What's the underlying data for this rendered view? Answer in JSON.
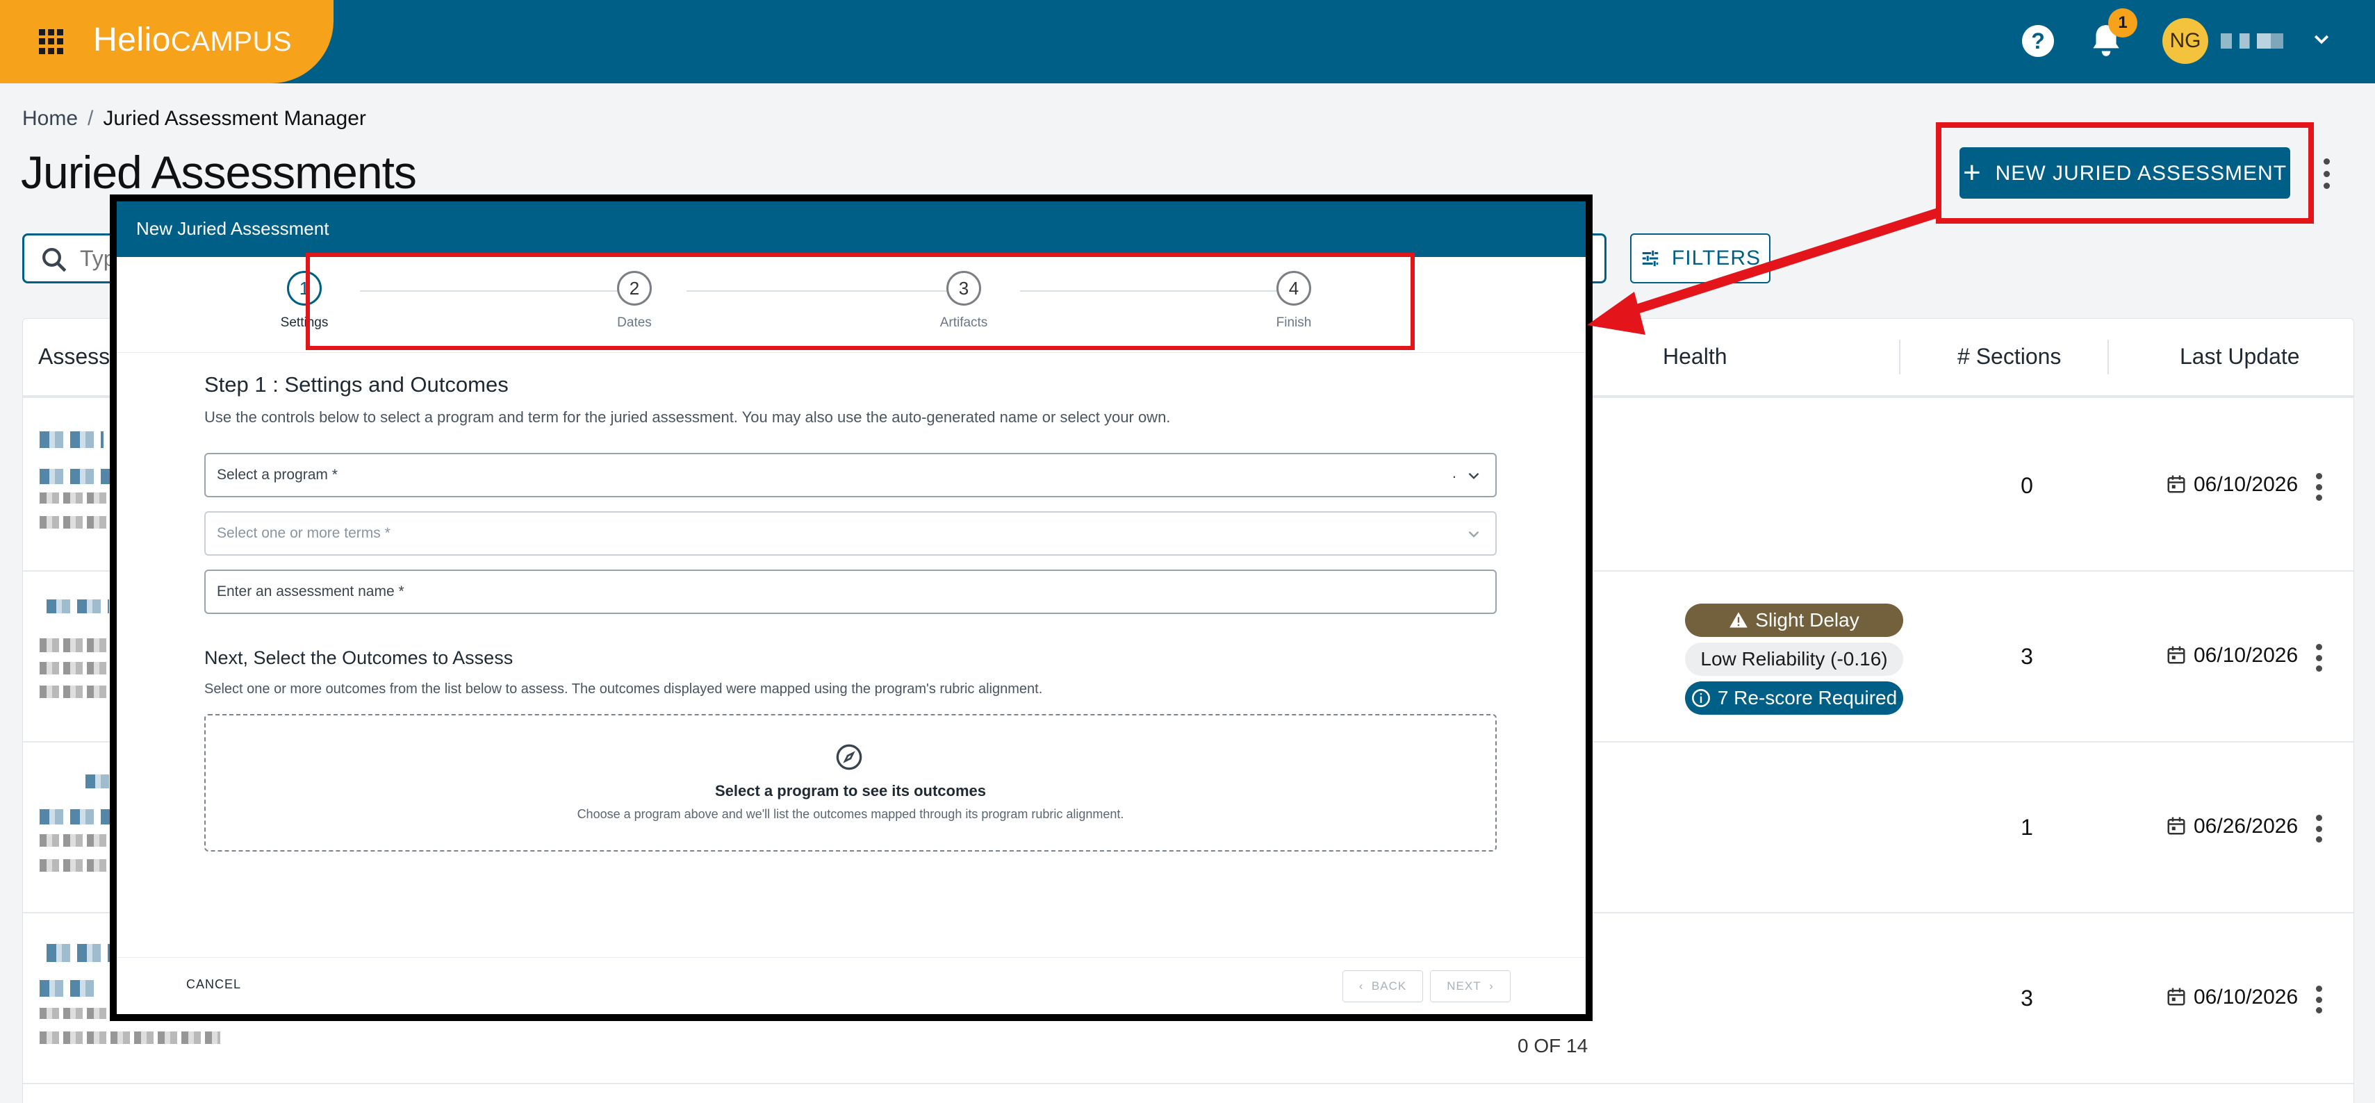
{
  "app": {
    "brand_primary": "Helio",
    "brand_secondary": "CAMPUS",
    "notification_count": "1",
    "user_initials": "NG"
  },
  "breadcrumb": {
    "home": "Home",
    "separator": "/",
    "current": "Juried Assessment Manager"
  },
  "page": {
    "title": "Juried Assessments",
    "new_button_label": "NEW JURIED ASSESSMENT",
    "search_placeholder": "Typ",
    "filters_label": "FILTERS"
  },
  "table": {
    "columns": [
      "Assessm",
      "Health",
      "# Sections",
      "Last Update"
    ],
    "rows": [
      {
        "sections": "0",
        "last_update": "06/10/2026"
      },
      {
        "sections": "3",
        "last_update": "06/10/2026",
        "health": [
          "Slight Delay",
          "Low Reliability (-0.16)",
          "7 Re-score Required"
        ]
      },
      {
        "sections": "1",
        "last_update": "06/26/2026"
      },
      {
        "sections": "3",
        "last_update": "06/10/2026",
        "progress": "0 OF 14"
      }
    ]
  },
  "modal": {
    "title": "New Juried Assessment",
    "steps": [
      {
        "number": "1",
        "label": "Settings"
      },
      {
        "number": "2",
        "label": "Dates"
      },
      {
        "number": "3",
        "label": "Artifacts"
      },
      {
        "number": "4",
        "label": "Finish"
      }
    ],
    "step_title": "Step 1 : Settings and Outcomes",
    "step_description": "Use the controls below to select a program and term for the juried assessment. You may also use the auto-generated name or select your own.",
    "program_field": "Select a program  *",
    "program_field_marker": ".",
    "terms_field": "Select one or more terms *",
    "name_field": "Enter an assessment name *",
    "outcomes_title": "Next, Select the Outcomes to Assess",
    "outcomes_description": "Select one or more outcomes from the list below to assess. The outcomes displayed were mapped using the program's rubric alignment.",
    "outcomes_empty_title": "Select a program to see its outcomes",
    "outcomes_empty_description": "Choose a program above and we'll list the outcomes mapped through its program rubric alignment.",
    "cancel_label": "CANCEL",
    "back_label": "BACK",
    "next_label": "NEXT"
  },
  "colors": {
    "brand_blue": "#005f87",
    "brand_orange": "#f7a21b",
    "annotation_red": "#e4141b"
  }
}
